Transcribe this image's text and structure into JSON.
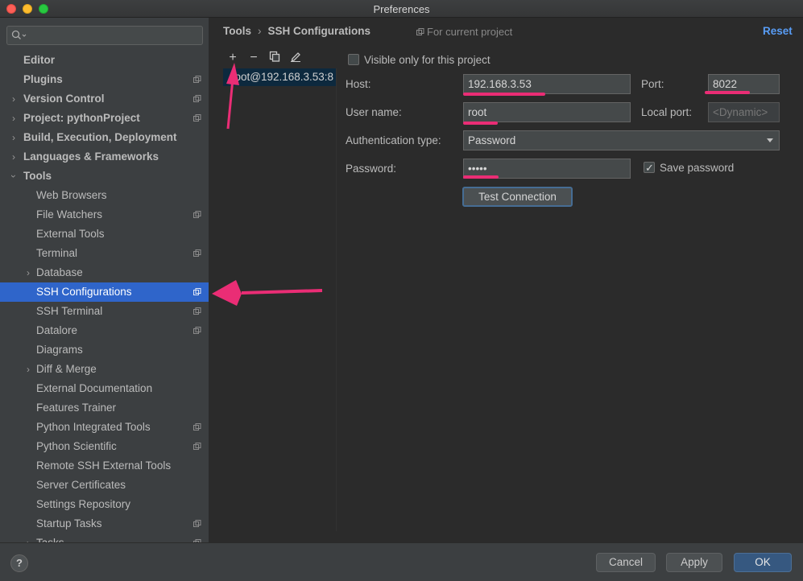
{
  "window": {
    "title": "Preferences"
  },
  "sidebar": {
    "search_placeholder": "",
    "items": [
      {
        "label": "Editor"
      },
      {
        "label": "Plugins"
      },
      {
        "label": "Version Control"
      },
      {
        "label": "Project: pythonProject"
      },
      {
        "label": "Build, Execution, Deployment"
      },
      {
        "label": "Languages & Frameworks"
      },
      {
        "label": "Tools"
      },
      {
        "label": "Web Browsers"
      },
      {
        "label": "File Watchers"
      },
      {
        "label": "External Tools"
      },
      {
        "label": "Terminal"
      },
      {
        "label": "Database"
      },
      {
        "label": "SSH Configurations"
      },
      {
        "label": "SSH Terminal"
      },
      {
        "label": "Datalore"
      },
      {
        "label": "Diagrams"
      },
      {
        "label": "Diff & Merge"
      },
      {
        "label": "External Documentation"
      },
      {
        "label": "Features Trainer"
      },
      {
        "label": "Python Integrated Tools"
      },
      {
        "label": "Python Scientific"
      },
      {
        "label": "Remote SSH External Tools"
      },
      {
        "label": "Server Certificates"
      },
      {
        "label": "Settings Repository"
      },
      {
        "label": "Startup Tasks"
      },
      {
        "label": "Tasks"
      }
    ]
  },
  "header": {
    "breadcrumb_parent": "Tools",
    "breadcrumb_separator": "›",
    "breadcrumb_current": "SSH Configurations",
    "scope": "For current project",
    "reset": "Reset"
  },
  "config_list": {
    "toolbar": {
      "add": "+",
      "remove": "−"
    },
    "items": [
      {
        "label": "root@192.168.3.53:8"
      }
    ]
  },
  "form": {
    "visible_only_label": "Visible only for this project",
    "visible_only_checked": false,
    "host_label": "Host:",
    "host_value": "192.168.3.53",
    "port_label": "Port:",
    "port_value": "8022",
    "username_label": "User name:",
    "username_value": "root",
    "local_port_label": "Local port:",
    "local_port_placeholder": "<Dynamic>",
    "auth_label": "Authentication type:",
    "auth_value": "Password",
    "password_label": "Password:",
    "password_value": "•••••",
    "save_password_label": "Save password",
    "save_password_checked": true,
    "test_connection": "Test Connection"
  },
  "footer": {
    "help": "?",
    "cancel": "Cancel",
    "apply": "Apply",
    "ok": "OK"
  },
  "colors": {
    "accent": "#2f65ca",
    "link": "#589df6",
    "annotation": "#ea2d75",
    "background": "#2b2b2b",
    "sidebar": "#3c3f41"
  }
}
